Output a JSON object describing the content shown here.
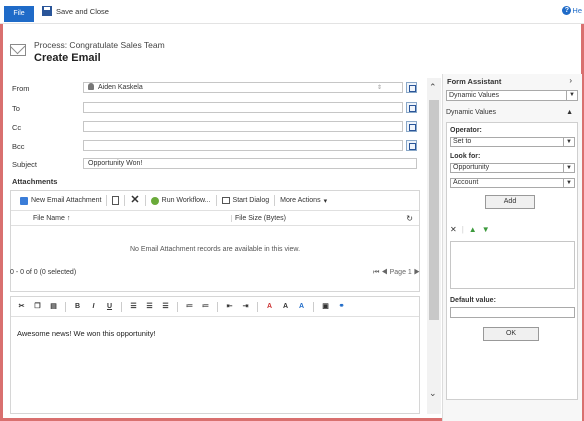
{
  "topbar": {
    "file_label": "File",
    "save_close_label": "Save and Close",
    "help_label": "He"
  },
  "header": {
    "process_label": "Process: Congratulate Sales Team",
    "title": "Create Email"
  },
  "fields": {
    "from": {
      "label": "From",
      "value": "Aiden Kaskela"
    },
    "to": {
      "label": "To",
      "value": ""
    },
    "cc": {
      "label": "Cc",
      "value": ""
    },
    "bcc": {
      "label": "Bcc",
      "value": ""
    },
    "subject": {
      "label": "Subject",
      "value": "Opportunity Won!"
    }
  },
  "attachments": {
    "title": "Attachments",
    "toolbar": {
      "new_attachment": "New Email Attachment",
      "run_workflow": "Run Workflow...",
      "start_dialog": "Start Dialog",
      "more_actions": "More Actions"
    },
    "columns": {
      "name": "File Name ↑",
      "size": "File Size (Bytes)"
    },
    "empty_message": "No Email Attachment records are available in this view.",
    "count": "0 - 0 of 0 (0 selected)",
    "page": "Page 1"
  },
  "editor": {
    "body": "Awesome news! We won this opportunity!"
  },
  "assistant": {
    "title": "Form Assistant",
    "mode_select": "Dynamic Values",
    "section": "Dynamic Values",
    "operator_label": "Operator:",
    "operator_value": "Set to",
    "lookfor_label": "Look for:",
    "lookfor_entity": "Opportunity",
    "lookfor_field": "Account",
    "add_label": "Add",
    "default_label": "Default value:",
    "ok_label": "OK"
  }
}
